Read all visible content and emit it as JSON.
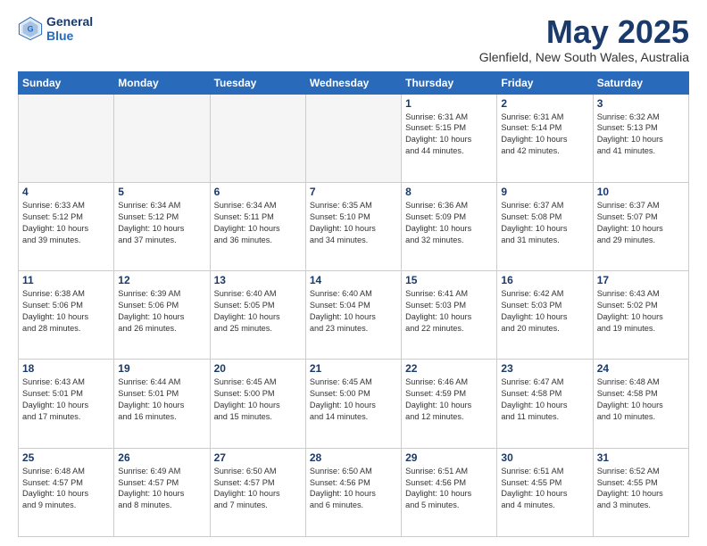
{
  "header": {
    "logo_line1": "General",
    "logo_line2": "Blue",
    "title": "May 2025",
    "location": "Glenfield, New South Wales, Australia"
  },
  "weekdays": [
    "Sunday",
    "Monday",
    "Tuesday",
    "Wednesday",
    "Thursday",
    "Friday",
    "Saturday"
  ],
  "weeks": [
    [
      {
        "day": "",
        "info": ""
      },
      {
        "day": "",
        "info": ""
      },
      {
        "day": "",
        "info": ""
      },
      {
        "day": "",
        "info": ""
      },
      {
        "day": "1",
        "info": "Sunrise: 6:31 AM\nSunset: 5:15 PM\nDaylight: 10 hours\nand 44 minutes."
      },
      {
        "day": "2",
        "info": "Sunrise: 6:31 AM\nSunset: 5:14 PM\nDaylight: 10 hours\nand 42 minutes."
      },
      {
        "day": "3",
        "info": "Sunrise: 6:32 AM\nSunset: 5:13 PM\nDaylight: 10 hours\nand 41 minutes."
      }
    ],
    [
      {
        "day": "4",
        "info": "Sunrise: 6:33 AM\nSunset: 5:12 PM\nDaylight: 10 hours\nand 39 minutes."
      },
      {
        "day": "5",
        "info": "Sunrise: 6:34 AM\nSunset: 5:12 PM\nDaylight: 10 hours\nand 37 minutes."
      },
      {
        "day": "6",
        "info": "Sunrise: 6:34 AM\nSunset: 5:11 PM\nDaylight: 10 hours\nand 36 minutes."
      },
      {
        "day": "7",
        "info": "Sunrise: 6:35 AM\nSunset: 5:10 PM\nDaylight: 10 hours\nand 34 minutes."
      },
      {
        "day": "8",
        "info": "Sunrise: 6:36 AM\nSunset: 5:09 PM\nDaylight: 10 hours\nand 32 minutes."
      },
      {
        "day": "9",
        "info": "Sunrise: 6:37 AM\nSunset: 5:08 PM\nDaylight: 10 hours\nand 31 minutes."
      },
      {
        "day": "10",
        "info": "Sunrise: 6:37 AM\nSunset: 5:07 PM\nDaylight: 10 hours\nand 29 minutes."
      }
    ],
    [
      {
        "day": "11",
        "info": "Sunrise: 6:38 AM\nSunset: 5:06 PM\nDaylight: 10 hours\nand 28 minutes."
      },
      {
        "day": "12",
        "info": "Sunrise: 6:39 AM\nSunset: 5:06 PM\nDaylight: 10 hours\nand 26 minutes."
      },
      {
        "day": "13",
        "info": "Sunrise: 6:40 AM\nSunset: 5:05 PM\nDaylight: 10 hours\nand 25 minutes."
      },
      {
        "day": "14",
        "info": "Sunrise: 6:40 AM\nSunset: 5:04 PM\nDaylight: 10 hours\nand 23 minutes."
      },
      {
        "day": "15",
        "info": "Sunrise: 6:41 AM\nSunset: 5:03 PM\nDaylight: 10 hours\nand 22 minutes."
      },
      {
        "day": "16",
        "info": "Sunrise: 6:42 AM\nSunset: 5:03 PM\nDaylight: 10 hours\nand 20 minutes."
      },
      {
        "day": "17",
        "info": "Sunrise: 6:43 AM\nSunset: 5:02 PM\nDaylight: 10 hours\nand 19 minutes."
      }
    ],
    [
      {
        "day": "18",
        "info": "Sunrise: 6:43 AM\nSunset: 5:01 PM\nDaylight: 10 hours\nand 17 minutes."
      },
      {
        "day": "19",
        "info": "Sunrise: 6:44 AM\nSunset: 5:01 PM\nDaylight: 10 hours\nand 16 minutes."
      },
      {
        "day": "20",
        "info": "Sunrise: 6:45 AM\nSunset: 5:00 PM\nDaylight: 10 hours\nand 15 minutes."
      },
      {
        "day": "21",
        "info": "Sunrise: 6:45 AM\nSunset: 5:00 PM\nDaylight: 10 hours\nand 14 minutes."
      },
      {
        "day": "22",
        "info": "Sunrise: 6:46 AM\nSunset: 4:59 PM\nDaylight: 10 hours\nand 12 minutes."
      },
      {
        "day": "23",
        "info": "Sunrise: 6:47 AM\nSunset: 4:58 PM\nDaylight: 10 hours\nand 11 minutes."
      },
      {
        "day": "24",
        "info": "Sunrise: 6:48 AM\nSunset: 4:58 PM\nDaylight: 10 hours\nand 10 minutes."
      }
    ],
    [
      {
        "day": "25",
        "info": "Sunrise: 6:48 AM\nSunset: 4:57 PM\nDaylight: 10 hours\nand 9 minutes."
      },
      {
        "day": "26",
        "info": "Sunrise: 6:49 AM\nSunset: 4:57 PM\nDaylight: 10 hours\nand 8 minutes."
      },
      {
        "day": "27",
        "info": "Sunrise: 6:50 AM\nSunset: 4:57 PM\nDaylight: 10 hours\nand 7 minutes."
      },
      {
        "day": "28",
        "info": "Sunrise: 6:50 AM\nSunset: 4:56 PM\nDaylight: 10 hours\nand 6 minutes."
      },
      {
        "day": "29",
        "info": "Sunrise: 6:51 AM\nSunset: 4:56 PM\nDaylight: 10 hours\nand 5 minutes."
      },
      {
        "day": "30",
        "info": "Sunrise: 6:51 AM\nSunset: 4:55 PM\nDaylight: 10 hours\nand 4 minutes."
      },
      {
        "day": "31",
        "info": "Sunrise: 6:52 AM\nSunset: 4:55 PM\nDaylight: 10 hours\nand 3 minutes."
      }
    ]
  ]
}
